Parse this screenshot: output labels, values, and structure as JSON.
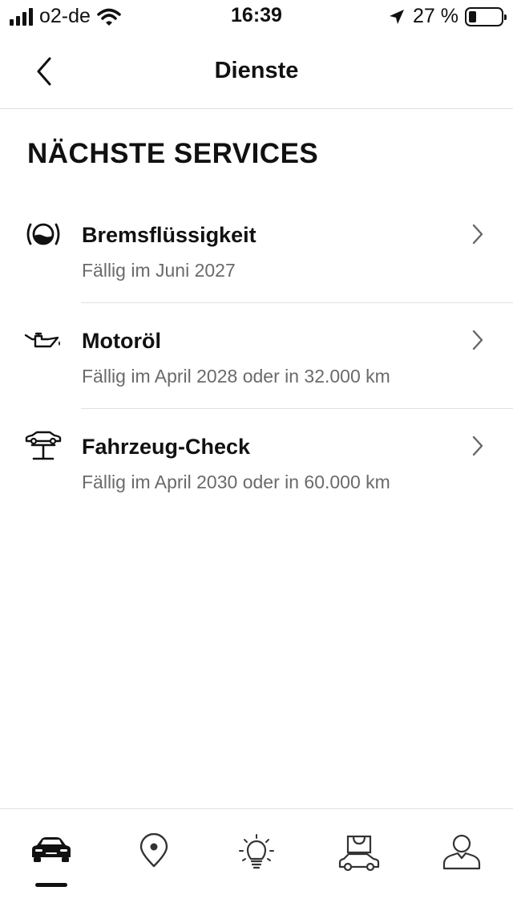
{
  "status_bar": {
    "carrier": "o2-de",
    "time": "16:39",
    "battery_percent": "27 %"
  },
  "header": {
    "title": "Dienste"
  },
  "section": {
    "title": "NÄCHSTE SERVICES"
  },
  "services": [
    {
      "name": "Bremsflüssigkeit",
      "due": "Fällig im Juni 2027",
      "icon": "brake-fluid-icon"
    },
    {
      "name": "Motoröl",
      "due": "Fällig im April 2028 oder in 32.000 km",
      "icon": "engine-oil-icon"
    },
    {
      "name": "Fahrzeug-Check",
      "due": "Fällig im April 2030 oder in 60.000 km",
      "icon": "vehicle-lift-icon"
    }
  ],
  "tab_bar": {
    "tabs": [
      {
        "icon": "car-icon",
        "active": true
      },
      {
        "icon": "location-pin-icon",
        "active": false
      },
      {
        "icon": "lightbulb-icon",
        "active": false
      },
      {
        "icon": "shop-car-icon",
        "active": false
      },
      {
        "icon": "profile-icon",
        "active": false
      }
    ]
  }
}
